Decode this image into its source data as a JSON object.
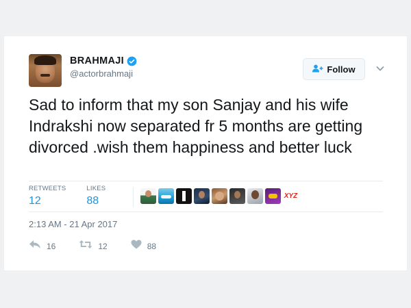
{
  "tweet": {
    "display_name": "BRAHMAJI",
    "handle": "@actorbrahmaji",
    "follow_label": "Follow",
    "text": "Sad to inform that my son Sanjay and his wife Indrakshi now separated fr 5 months are getting divorced .wish them happiness and better luck",
    "retweets_label": "RETWEETS",
    "retweets_count": "12",
    "likes_label": "LIKES",
    "likes_count": "88",
    "timestamp": "2:13 AM - 21 Apr 2017",
    "actions": {
      "reply_count": "16",
      "retweet_count": "12",
      "like_count": "88"
    },
    "liker_avatars": [
      "person-avatar",
      "pool-avatar",
      "number-one-avatar",
      "portrait-avatar",
      "group-avatar",
      "portrait-avatar",
      "portrait-avatar",
      "logo-avatar",
      "xyz-logo-avatar"
    ],
    "liker_logo_text": "XYZ"
  },
  "colors": {
    "accent": "#1b95e0",
    "text": "#14171a",
    "muted": "#657786",
    "verified": "#1da1f2"
  }
}
